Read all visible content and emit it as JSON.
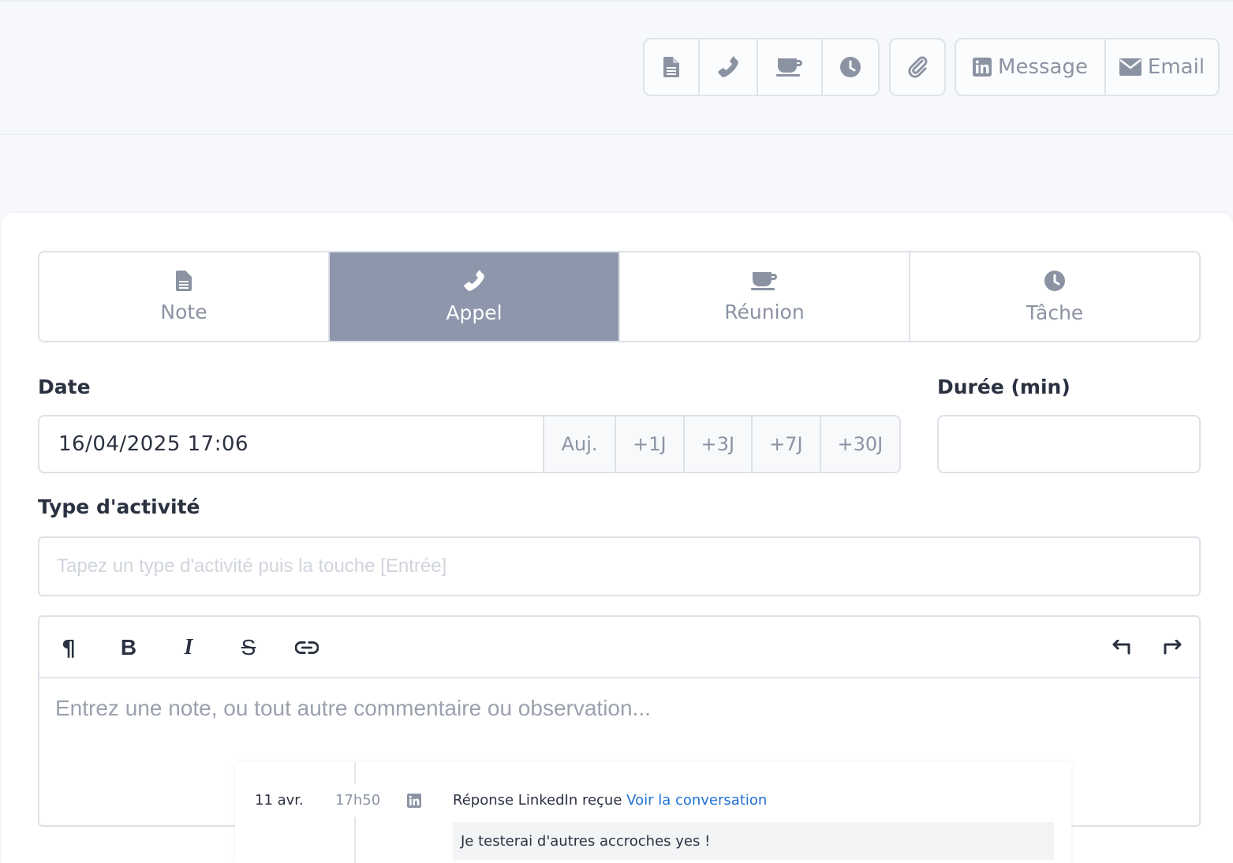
{
  "header": {
    "actions_group1": [
      {
        "icon": "file-text-icon"
      },
      {
        "icon": "phone-icon"
      },
      {
        "icon": "coffee-cup-icon"
      },
      {
        "icon": "clock-icon"
      }
    ],
    "attach_icon": "paperclip-icon",
    "message_label": "Message",
    "email_label": "Email"
  },
  "tabs": [
    {
      "label": "Note",
      "icon": "file-text-icon",
      "active": false
    },
    {
      "label": "Appel",
      "icon": "phone-icon",
      "active": true
    },
    {
      "label": "Réunion",
      "icon": "coffee-cup-icon",
      "active": false
    },
    {
      "label": "Tâche",
      "icon": "clock-icon",
      "active": false
    }
  ],
  "form": {
    "date_label": "Date",
    "date_value": "16/04/2025 17:06",
    "quick_dates": [
      "Auj.",
      "+1J",
      "+3J",
      "+7J",
      "+30J"
    ],
    "duree_label": "Durée (min)",
    "duree_value": "",
    "type_label": "Type d'activité",
    "type_placeholder": "Tapez un type d'activité puis la touche [Entrée]",
    "editor_placeholder": "Entrez une note, ou tout autre commentaire ou observation..."
  },
  "editor_toolbar": {
    "paragraph": "¶",
    "bold": "B",
    "italic": "I",
    "strike": "S"
  },
  "timeline_entry": {
    "date": "11 avr.",
    "time": "17h50",
    "icon": "linkedin-icon",
    "text": "Réponse LinkedIn reçue",
    "link": "Voir la conversation",
    "message": "Je testerai d'autres accroches yes !"
  },
  "colors": {
    "active_tab": "#8d96ab",
    "link": "#1f6fd1",
    "muted": "#8b93a3"
  }
}
